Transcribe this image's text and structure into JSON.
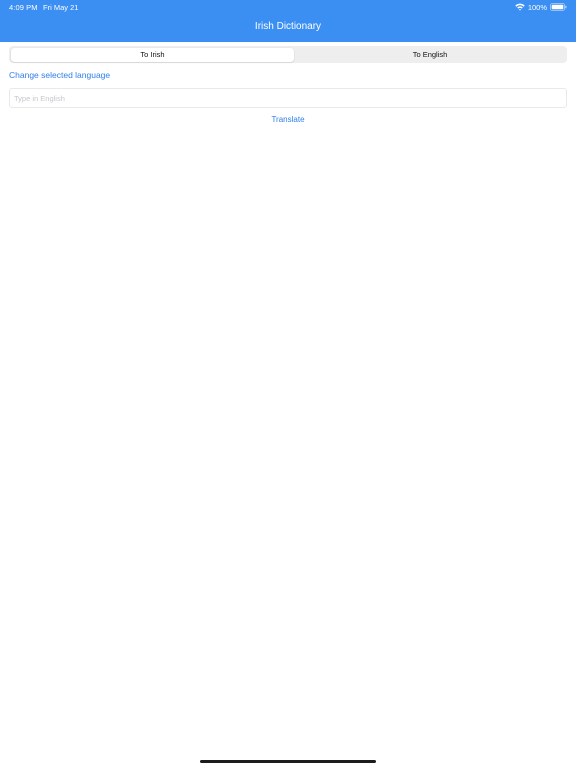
{
  "status_bar": {
    "time": "4:09 PM",
    "date": "Fri May 21",
    "battery_percent": "100%",
    "wifi_icon": "wifi-icon",
    "battery_icon": "battery-icon"
  },
  "header": {
    "title": "Irish Dictionary",
    "background_color": "#3b8ff3"
  },
  "direction_control": {
    "segments": [
      {
        "label": "To Irish",
        "selected": true
      },
      {
        "label": "To English",
        "selected": false
      }
    ]
  },
  "language_link": {
    "label": "Change selected language"
  },
  "input": {
    "value": "",
    "placeholder": "Type in English"
  },
  "translate_button": {
    "label": "Translate"
  },
  "colors": {
    "accent": "#2f80e8"
  }
}
